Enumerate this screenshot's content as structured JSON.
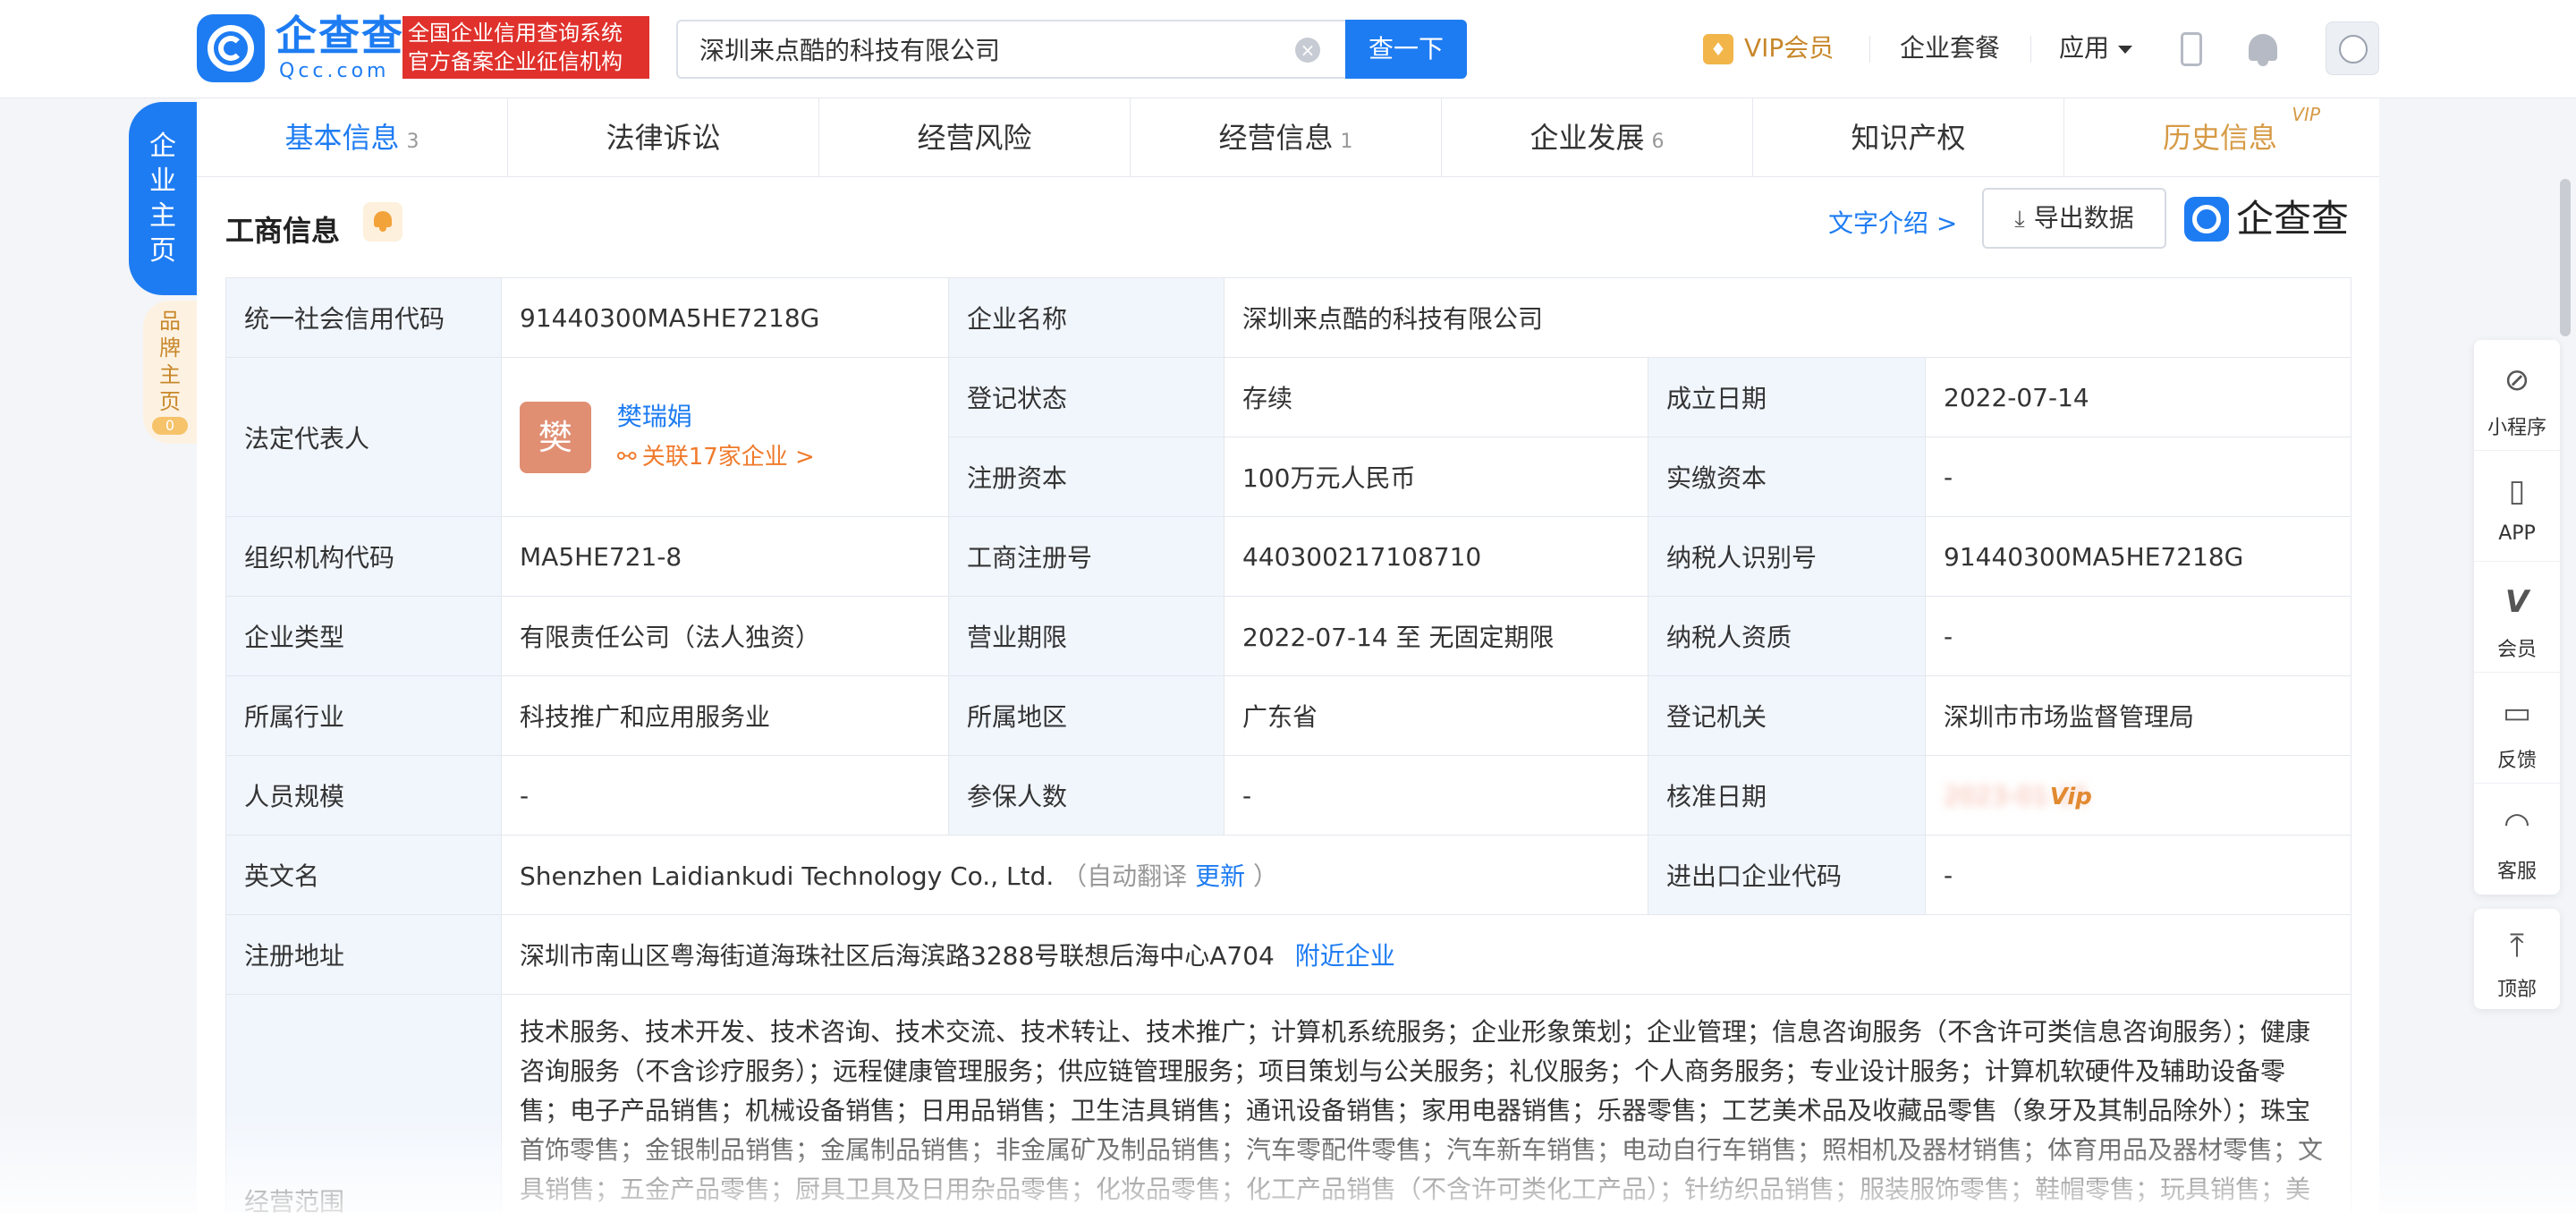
{
  "header": {
    "logo_title": "企查查",
    "logo_sub": "Qcc.com",
    "slogan_line1": "全国企业信用查询系统",
    "slogan_line2": "官方备案企业征信机构",
    "search_value": "深圳来点酷的科技有限公司",
    "search_button": "查一下",
    "vip_label": "VIP会员",
    "enterprise_plan": "企业套餐",
    "apps": "应用"
  },
  "side_tabs": {
    "main_label": [
      "企",
      "业",
      "主",
      "页"
    ],
    "brand_label": [
      "品",
      "牌",
      "主",
      "页"
    ],
    "brand_count": "0"
  },
  "tabs": [
    {
      "label": "基本信息",
      "count": "3"
    },
    {
      "label": "法律诉讼",
      "count": ""
    },
    {
      "label": "经营风险",
      "count": ""
    },
    {
      "label": "经营信息",
      "count": "1"
    },
    {
      "label": "企业发展",
      "count": "6"
    },
    {
      "label": "知识产权",
      "count": ""
    },
    {
      "label": "历史信息",
      "count": "",
      "tag": "VIP"
    }
  ],
  "section": {
    "title": "工商信息",
    "text_intro": "文字介绍 >",
    "export": "导出数据",
    "brand": "企查查"
  },
  "info": {
    "credit_code_label": "统一社会信用代码",
    "credit_code": "91440300MA5HE7218G",
    "company_name_label": "企业名称",
    "company_name": "深圳来点酷的科技有限公司",
    "legal_rep_label": "法定代表人",
    "legal_rep_avatar": "樊",
    "legal_rep_name": "樊瑞娟",
    "legal_rep_assoc": "关联17家企业 >",
    "reg_status_label": "登记状态",
    "reg_status": "存续",
    "found_date_label": "成立日期",
    "found_date": "2022-07-14",
    "reg_capital_label": "注册资本",
    "reg_capital": "100万元人民币",
    "paid_capital_label": "实缴资本",
    "paid_capital": "-",
    "org_code_label": "组织机构代码",
    "org_code": "MA5HE721-8",
    "biz_reg_no_label": "工商注册号",
    "biz_reg_no": "440300217108710",
    "taxpayer_id_label": "纳税人识别号",
    "taxpayer_id": "91440300MA5HE7218G",
    "company_type_label": "企业类型",
    "company_type": "有限责任公司（法人独资）",
    "biz_term_label": "营业期限",
    "biz_term": "2022-07-14 至 无固定期限",
    "taxpayer_qual_label": "纳税人资质",
    "taxpayer_qual": "-",
    "industry_label": "所属行业",
    "industry": "科技推广和应用服务业",
    "region_label": "所属地区",
    "region": "广东省",
    "reg_authority_label": "登记机关",
    "reg_authority": "深圳市市场监督管理局",
    "staff_size_label": "人员规模",
    "staff_size": "-",
    "insured_label": "参保人数",
    "insured": "-",
    "approval_date_label": "核准日期",
    "approval_date_blurred": "2023-01-15",
    "approval_vip": "Vip",
    "english_name_label": "英文名",
    "english_name": "Shenzhen Laidiankudi Technology Co., Ltd.",
    "auto_translate": "（自动翻译",
    "update": "更新",
    "auto_translate_end": "）",
    "import_export_label": "进出口企业代码",
    "import_export": "-",
    "address_label": "注册地址",
    "address": "深圳市南山区粤海街道海珠社区后海滨路3288号联想后海中心A704",
    "nearby": "附近企业",
    "scope_label": "经营范围",
    "scope": "技术服务、技术开发、技术咨询、技术交流、技术转让、技术推广；计算机系统服务；企业形象策划；企业管理；信息咨询服务（不含许可类信息咨询服务）；健康咨询服务（不含诊疗服务）；远程健康管理服务；供应链管理服务；项目策划与公关服务；礼仪服务；个人商务服务；专业设计服务；计算机软硬件及辅助设备零售；电子产品销售；机械设备销售；日用品销售；卫生洁具销售；通讯设备销售；家用电器销售；乐器零售；工艺美术品及收藏品零售（象牙及其制品除外）；珠宝首饰零售；金银制品销售；金属制品销售；非金属矿及制品销售；汽车零配件零售；汽车新车销售；电动自行车销售；照相机及器材销售；体育用品及器材零售；文具销售；五金产品零售；厨具卫具及日用杂品零售；化妆品零售；化工产品销售（不含许可类化工产品）；针纺织品销售；服装服饰零售；鞋帽零售；玩具销售；美"
  },
  "float_bar": {
    "items": [
      "小程序",
      "APP",
      "会员",
      "反馈",
      "客服"
    ],
    "top": "顶部"
  },
  "colors": {
    "brand_blue": "#1e7cf2",
    "label_bg": "#f1f6fd",
    "accent_orange": "#f07a2b",
    "vip_gold": "#c8872a",
    "slogan_red": "#e0312c"
  }
}
